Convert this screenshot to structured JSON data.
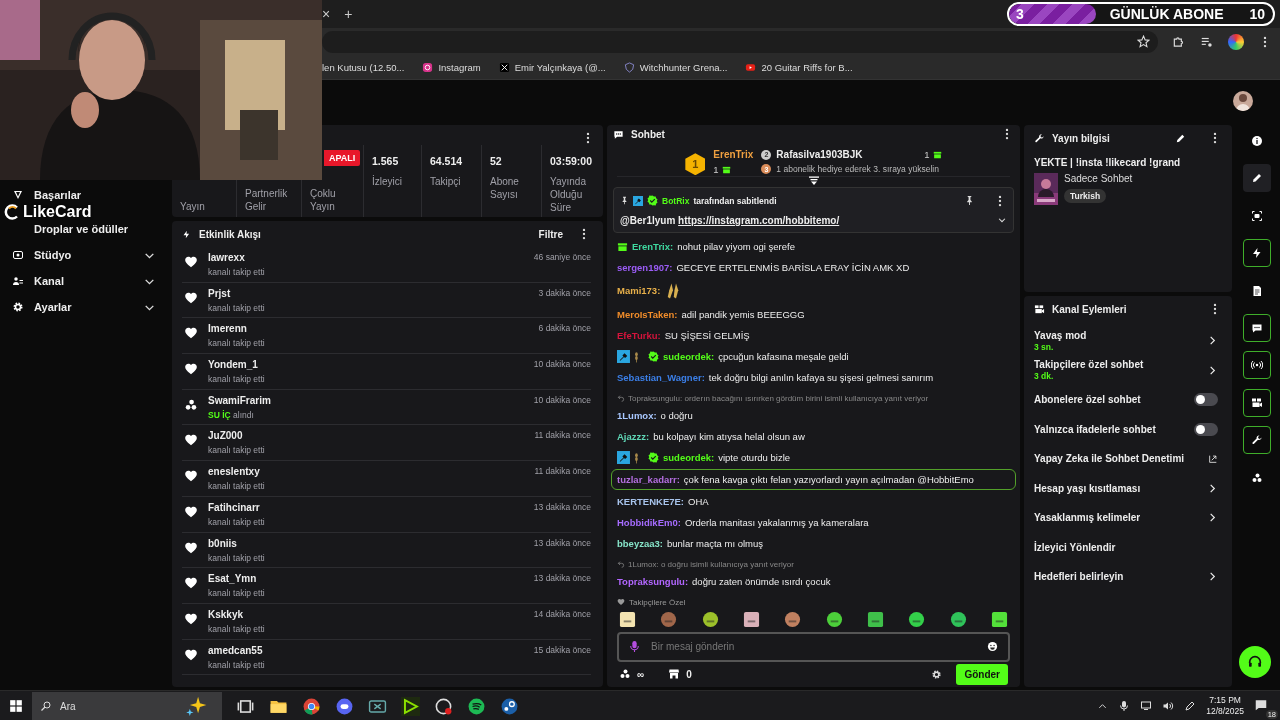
{
  "browser": {
    "tab_close": "×",
    "new_tab": "+",
    "bookmarks": [
      {
        "kind": "page",
        "label": "len Kutusu (12.50..."
      },
      {
        "kind": "instagram",
        "label": "Instagram"
      },
      {
        "kind": "x",
        "label": "Emir Yalçınkaya (@..."
      },
      {
        "kind": "shield",
        "label": "Witchhunter Grena..."
      },
      {
        "kind": "video",
        "label": "20 Guitar Riffs for B..."
      }
    ]
  },
  "sub_goal": {
    "current": "3",
    "label": "GÜNLÜK ABONE",
    "target": "10",
    "level": 0.33
  },
  "sidebar": {
    "items": [
      {
        "kind": "trophy",
        "label": "Başarılar",
        "expanded": false
      },
      {
        "kind": "drops",
        "label": "Droplar ve ödüller",
        "expanded": false
      },
      {
        "kind": "studio",
        "label": "Stüdyo",
        "expanded": false
      },
      {
        "kind": "channel",
        "label": "Kanal",
        "expanded": false
      },
      {
        "kind": "settings",
        "label": "Ayarlar",
        "expanded": false
      }
    ]
  },
  "overlay": {
    "logo": "LikeCard"
  },
  "stats": {
    "status": "APALI",
    "tabs": [
      {
        "label": "Yayın"
      },
      {
        "label": "Partnerlik Gelir"
      },
      {
        "label": "Çoklu Yayın"
      }
    ],
    "metrics": [
      {
        "value": "1.565",
        "label": "İzleyici"
      },
      {
        "value": "64.514",
        "label": "Takipçi"
      },
      {
        "value": "52",
        "label": "Abone Sayısı"
      },
      {
        "value": "03:59:00",
        "label": "Yayında Olduğu Süre"
      }
    ]
  },
  "activity": {
    "title": "Etkinlik Akışı",
    "filter": "Filtre",
    "events": [
      {
        "kind": "follow",
        "user": "lawrexx",
        "action": "kanalı takip etti",
        "time": "46 saniye önce"
      },
      {
        "kind": "follow",
        "user": "Prjst",
        "action": "kanalı takip etti",
        "time": "3 dakika önce"
      },
      {
        "kind": "follow",
        "user": "Imerenn",
        "action": "kanalı takip etti",
        "time": "6 dakika önce"
      },
      {
        "kind": "follow",
        "user": "Yondem_1",
        "action": "kanalı takip etti",
        "time": "10 dakika önce"
      },
      {
        "kind": "reward",
        "user": "SwamiFrarim",
        "reward": "SU İÇ",
        "action": "alındı",
        "time": "10 dakika önce"
      },
      {
        "kind": "follow",
        "user": "JuZ000",
        "action": "kanalı takip etti",
        "time": "11 dakika önce"
      },
      {
        "kind": "follow",
        "user": "eneslentxy",
        "action": "kanalı takip etti",
        "time": "11 dakika önce"
      },
      {
        "kind": "follow",
        "user": "Fatihcinarr",
        "action": "kanalı takip etti",
        "time": "13 dakika önce"
      },
      {
        "kind": "follow",
        "user": "b0niis",
        "action": "kanalı takip etti",
        "time": "13 dakika önce"
      },
      {
        "kind": "follow",
        "user": "Esat_Ymn",
        "action": "kanalı takip etti",
        "time": "13 dakika önce"
      },
      {
        "kind": "follow",
        "user": "Kskkyk",
        "action": "kanalı takip etti",
        "time": "14 dakika önce"
      },
      {
        "kind": "follow",
        "user": "amedcan55",
        "action": "kanalı takip etti",
        "time": "15 dakika önce"
      }
    ]
  },
  "chat": {
    "title": "Sohbet",
    "leaders": [
      {
        "rank": "1",
        "name": "ErenTrix",
        "count": "1"
      },
      {
        "rank": "2",
        "name": "Rafasilva1903BJK",
        "count": "1"
      }
    ],
    "leader_hint": {
      "rank": "3",
      "text": "1 abonelik hediye ederek 3. sıraya yükselin"
    },
    "pinned": {
      "by": "BotRix",
      "note": "tarafından sabitlendi",
      "mention": "@Ber1lyum",
      "link": "https://instagram.com/hobbitemo/"
    },
    "messages": [
      {
        "kind": "text",
        "user": "ErenTrix:",
        "color": "#3fd9a0",
        "gifter": true,
        "moderator": false,
        "verified": false,
        "text": "nohut pilav yiyom ogi şerefe",
        "highlighted": false
      },
      {
        "kind": "text",
        "user": "sergen1907:",
        "color": "#9b5cf6",
        "gifter": false,
        "moderator": false,
        "verified": false,
        "text": "GECEYE ERTELENMİS BARİSLA ERAY İCİN AMK XD",
        "highlighted": false
      },
      {
        "kind": "emote",
        "user": "Mami173:",
        "color": "#e8b04a",
        "gifter": false,
        "moderator": false,
        "verified": false,
        "highlighted": false
      },
      {
        "kind": "text",
        "user": "MeroIsTaken:",
        "color": "#f08c2a",
        "gifter": false,
        "moderator": false,
        "verified": false,
        "text": "adil pandik yemis BEEEGGG",
        "highlighted": false
      },
      {
        "kind": "text",
        "user": "EfeTurku:",
        "color": "#d4143c",
        "gifter": false,
        "moderator": false,
        "verified": false,
        "text": "SU ŞİŞESİ GELMİŞ",
        "highlighted": false
      },
      {
        "kind": "text",
        "user": "sudeordek:",
        "color": "#53fc18",
        "gifter": false,
        "moderator": true,
        "verified": true,
        "text": "çpcuğun kafasına meşale geldi",
        "highlighted": false
      },
      {
        "kind": "text",
        "user": "Sebastian_Wagner:",
        "color": "#3b7fe8",
        "gifter": false,
        "moderator": false,
        "verified": false,
        "text": "tek doğru bilgi anılın kafaya su şişesi gelmesi sanırım",
        "highlighted": false
      },
      {
        "kind": "text",
        "user": "1Lumox:",
        "color": "#a9c8ff",
        "gifter": false,
        "moderator": false,
        "verified": false,
        "reply_to": "Topraksungulu: orderın bacağını ısırırken gördüm birini isimli kullanıcıya yanıt veriyor",
        "text": "o doğru",
        "highlighted": false
      },
      {
        "kind": "text",
        "user": "Ajazzz:",
        "color": "#5fd6b6",
        "gifter": false,
        "moderator": false,
        "verified": false,
        "text": "bu kolpayı kim atıysa helal olsun aw",
        "highlighted": false
      },
      {
        "kind": "text",
        "user": "sudeordek:",
        "color": "#53fc18",
        "gifter": false,
        "moderator": true,
        "verified": true,
        "text": "vipte oturdu bizle",
        "highlighted": false
      },
      {
        "kind": "text",
        "user": "tuzlar_kadarr:",
        "color": "#b46ee0",
        "gifter": false,
        "moderator": false,
        "verified": false,
        "text": "çok fena kavga çıktı felan yazıyorlardı yayın açılmadan @HobbitEmo",
        "highlighted": true
      },
      {
        "kind": "text",
        "user": "KERTENKE7E:",
        "color": "#a8c4ec",
        "gifter": false,
        "moderator": false,
        "verified": false,
        "text": "OHA",
        "highlighted": false
      },
      {
        "kind": "text",
        "user": "HobbidikEm0:",
        "color": "#a66cff",
        "gifter": false,
        "moderator": false,
        "verified": false,
        "text": "Orderla manitası yakalanmış ya kameralara",
        "highlighted": false
      },
      {
        "kind": "text",
        "user": "bbeyzaa3:",
        "color": "#86e3c8",
        "gifter": false,
        "moderator": false,
        "verified": false,
        "text": "bunlar maçta mı olmuş",
        "highlighted": false
      },
      {
        "kind": "text",
        "user": "Topraksungulu:",
        "color": "#b266ff",
        "gifter": false,
        "moderator": false,
        "verified": false,
        "reply_to": "1Lumox: o doğru isimli kullanıcıya yanıt veriyor",
        "text": "doğru zaten önümde ısırdı çocuk",
        "highlighted": false
      }
    ],
    "followers_only": "Takipçilere Özel",
    "emotes": [
      {
        "color": "#f3e3b0"
      },
      {
        "color": "#a0664a"
      },
      {
        "color": "#9cc02a"
      },
      {
        "color": "#d9b0b8"
      },
      {
        "color": "#c08060"
      },
      {
        "color": "#4ccf3a"
      },
      {
        "color": "#3fbf4a"
      },
      {
        "color": "#33d04a"
      },
      {
        "color": "#2fc25a"
      },
      {
        "color": "#53e03a"
      }
    ],
    "input": {
      "placeholder": "Bir mesaj gönderin"
    },
    "points": "∞",
    "store_count": "0",
    "send": "Gönder"
  },
  "stream_info": {
    "title": "Yayın bilgisi",
    "stream_title": "YEKTE | !insta !likecard !grand",
    "category": "Sadece Sohbet",
    "tag": "Turkish"
  },
  "channel_actions": {
    "title": "Kanal Eylemleri",
    "items": [
      {
        "kind": "submenu",
        "label": "Yavaş mod",
        "value": "3 sn."
      },
      {
        "kind": "submenu",
        "label": "Takipçilere özel sohbet",
        "value": "3 dk."
      },
      {
        "kind": "toggle",
        "label": "Abonelere özel sohbet",
        "on": false
      },
      {
        "kind": "toggle",
        "label": "Yalnızca ifadelerle sohbet",
        "on": false
      },
      {
        "kind": "external",
        "label": "Yapay Zeka ile Sohbet Denetimi"
      },
      {
        "kind": "submenu",
        "label": "Hesap yaşı kısıtlaması"
      },
      {
        "kind": "submenu",
        "label": "Yasaklanmış kelimeler"
      },
      {
        "kind": "plain",
        "label": "İzleyici Yönlendir"
      },
      {
        "kind": "submenu",
        "label": "Hedefleri belirleyin"
      }
    ]
  },
  "rail": [
    {
      "kind": "info",
      "selected": false,
      "active": false
    },
    {
      "kind": "pencil",
      "selected": true,
      "active": false
    },
    {
      "kind": "screen",
      "selected": false,
      "active": false
    },
    {
      "kind": "bolt",
      "selected": false,
      "active": true
    },
    {
      "kind": "doc",
      "selected": false,
      "active": false
    },
    {
      "kind": "chat",
      "selected": false,
      "active": true
    },
    {
      "kind": "broadcast",
      "selected": false,
      "active": true
    },
    {
      "kind": "camera",
      "selected": false,
      "active": true
    },
    {
      "kind": "wrench",
      "selected": false,
      "active": true
    },
    {
      "kind": "dots",
      "selected": false,
      "active": false
    }
  ],
  "taskbar": {
    "search": "Ara",
    "apps": [
      {
        "kind": "taskview"
      },
      {
        "kind": "folder"
      },
      {
        "kind": "browser"
      },
      {
        "kind": "discord"
      },
      {
        "kind": "xbox"
      },
      {
        "kind": "play"
      },
      {
        "kind": "obs"
      },
      {
        "kind": "music"
      },
      {
        "kind": "steam"
      }
    ],
    "time": "7:15 PM",
    "date": "12/8/2025",
    "notifications": "18"
  }
}
